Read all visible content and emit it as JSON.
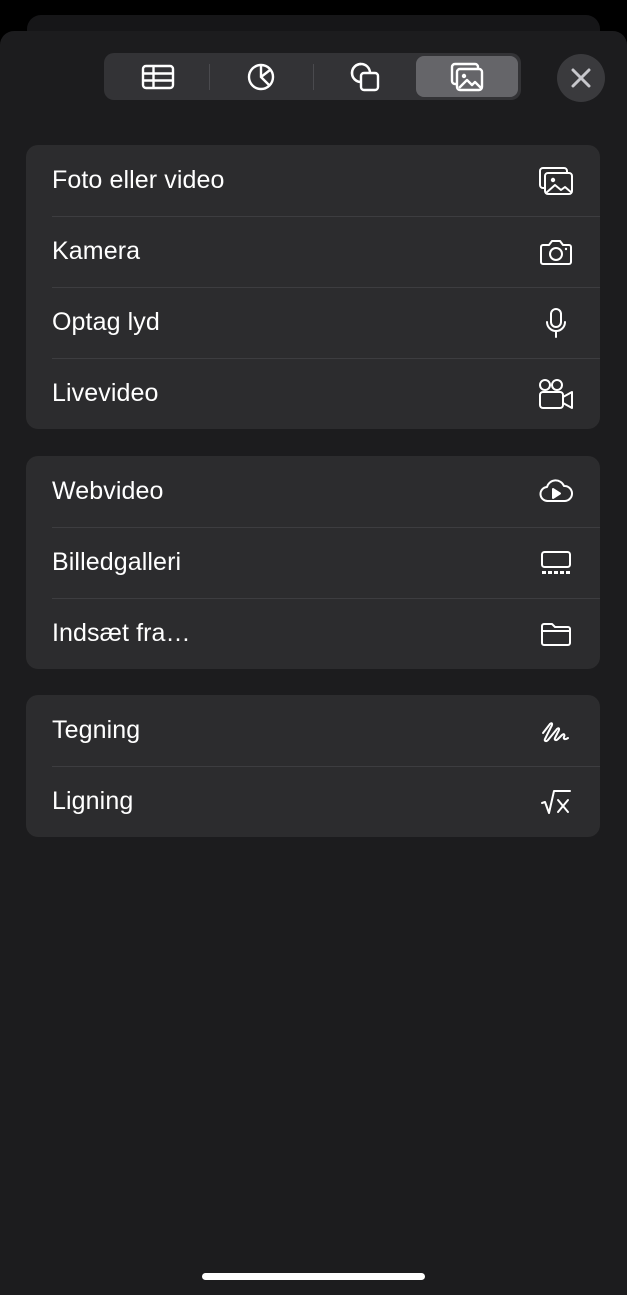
{
  "toolbar": {
    "tabs": [
      {
        "icon": "table-icon",
        "selected": false
      },
      {
        "icon": "chart-icon",
        "selected": false
      },
      {
        "icon": "shapes-icon",
        "selected": false
      },
      {
        "icon": "media-icon",
        "selected": true
      }
    ],
    "close_icon": "close-icon"
  },
  "groups": [
    {
      "items": [
        {
          "label": "Foto eller video",
          "icon": "photo-library-icon"
        },
        {
          "label": "Kamera",
          "icon": "camera-icon"
        },
        {
          "label": "Optag lyd",
          "icon": "microphone-icon"
        },
        {
          "label": "Livevideo",
          "icon": "video-camera-icon"
        }
      ]
    },
    {
      "items": [
        {
          "label": "Webvideo",
          "icon": "cloud-play-icon"
        },
        {
          "label": "Billedgalleri",
          "icon": "image-gallery-icon"
        },
        {
          "label": "Indsæt fra…",
          "icon": "folder-icon"
        }
      ]
    },
    {
      "items": [
        {
          "label": "Tegning",
          "icon": "scribble-icon"
        },
        {
          "label": "Ligning",
          "icon": "square-root-icon"
        }
      ]
    }
  ],
  "colors": {
    "sheet": "#1c1c1e",
    "group": "#2c2c2e",
    "selected_tab": "#656569"
  }
}
